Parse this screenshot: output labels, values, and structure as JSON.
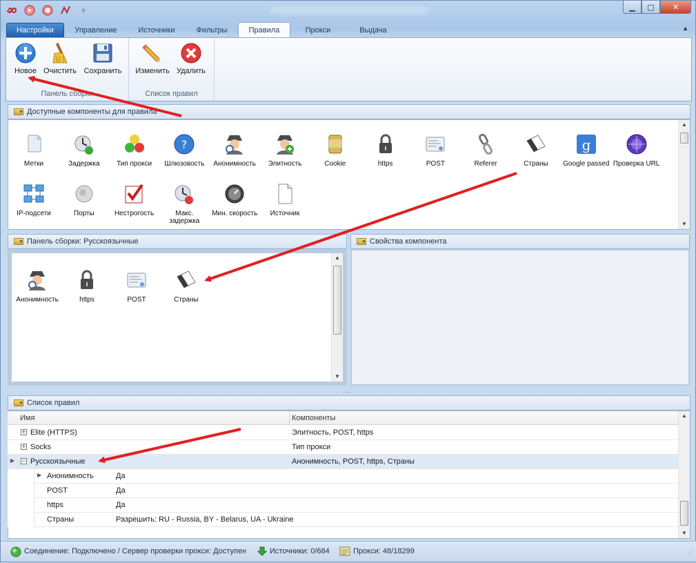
{
  "ribbon_tabs": [
    "Настройки",
    "Управление",
    "Источники",
    "Фильтры",
    "Правила",
    "Прокси",
    "Выдача"
  ],
  "active_tab": "Правила",
  "ribbon": {
    "group1": {
      "label": "Панель сборки",
      "new": "Новое",
      "clear": "Очистить",
      "save": "Сохранить"
    },
    "group2": {
      "label": "Список правил",
      "edit": "Изменить",
      "delete": "Удалить"
    }
  },
  "available": {
    "title": "Доступные компоненты для правила",
    "row1": [
      "Метки",
      "Задержка",
      "Тип прокси",
      "Шлюзовость",
      "Анонимность",
      "Элитность",
      "Cookie",
      "https",
      "POST",
      "Referer",
      "Страны",
      "Google passed",
      "Проверка URL"
    ],
    "row2": [
      "IP-подсети",
      "Порты",
      "Нестрогость",
      "Макс. задержка",
      "Мин. скорость",
      "Источник"
    ]
  },
  "assembly": {
    "title": "Панель сборки: Русскоязычные",
    "items": [
      "Анонимность",
      "https",
      "POST",
      "Страны"
    ]
  },
  "properties": {
    "title": "Свойства компонента"
  },
  "rules": {
    "title": "Список правил",
    "col_name": "Имя",
    "col_components": "Компоненты",
    "rows": [
      {
        "name": "Elite (HTTPS)",
        "components": "Элитность, POST, https"
      },
      {
        "name": "Socks",
        "components": "Тип прокси"
      },
      {
        "name": "Русскоязычные",
        "components": "Анонимность, POST, https, Страны"
      }
    ],
    "children": [
      {
        "name": "Анонимность",
        "value": "Да"
      },
      {
        "name": "POST",
        "value": "Да"
      },
      {
        "name": "https",
        "value": "Да"
      },
      {
        "name": "Страны",
        "value": "Разрешить: RU - Russia, BY - Belarus, UA - Ukraine"
      }
    ]
  },
  "status": {
    "connection": "Соединение: Подключено / Сервер проверки прокси: Доступен",
    "sources": "Источники: 0/684",
    "proxies": "Прокси: 48/18299"
  },
  "colors": {
    "accent": "#1f5fb2",
    "arrow": "#e02020",
    "selection": "#dfe9f6"
  }
}
